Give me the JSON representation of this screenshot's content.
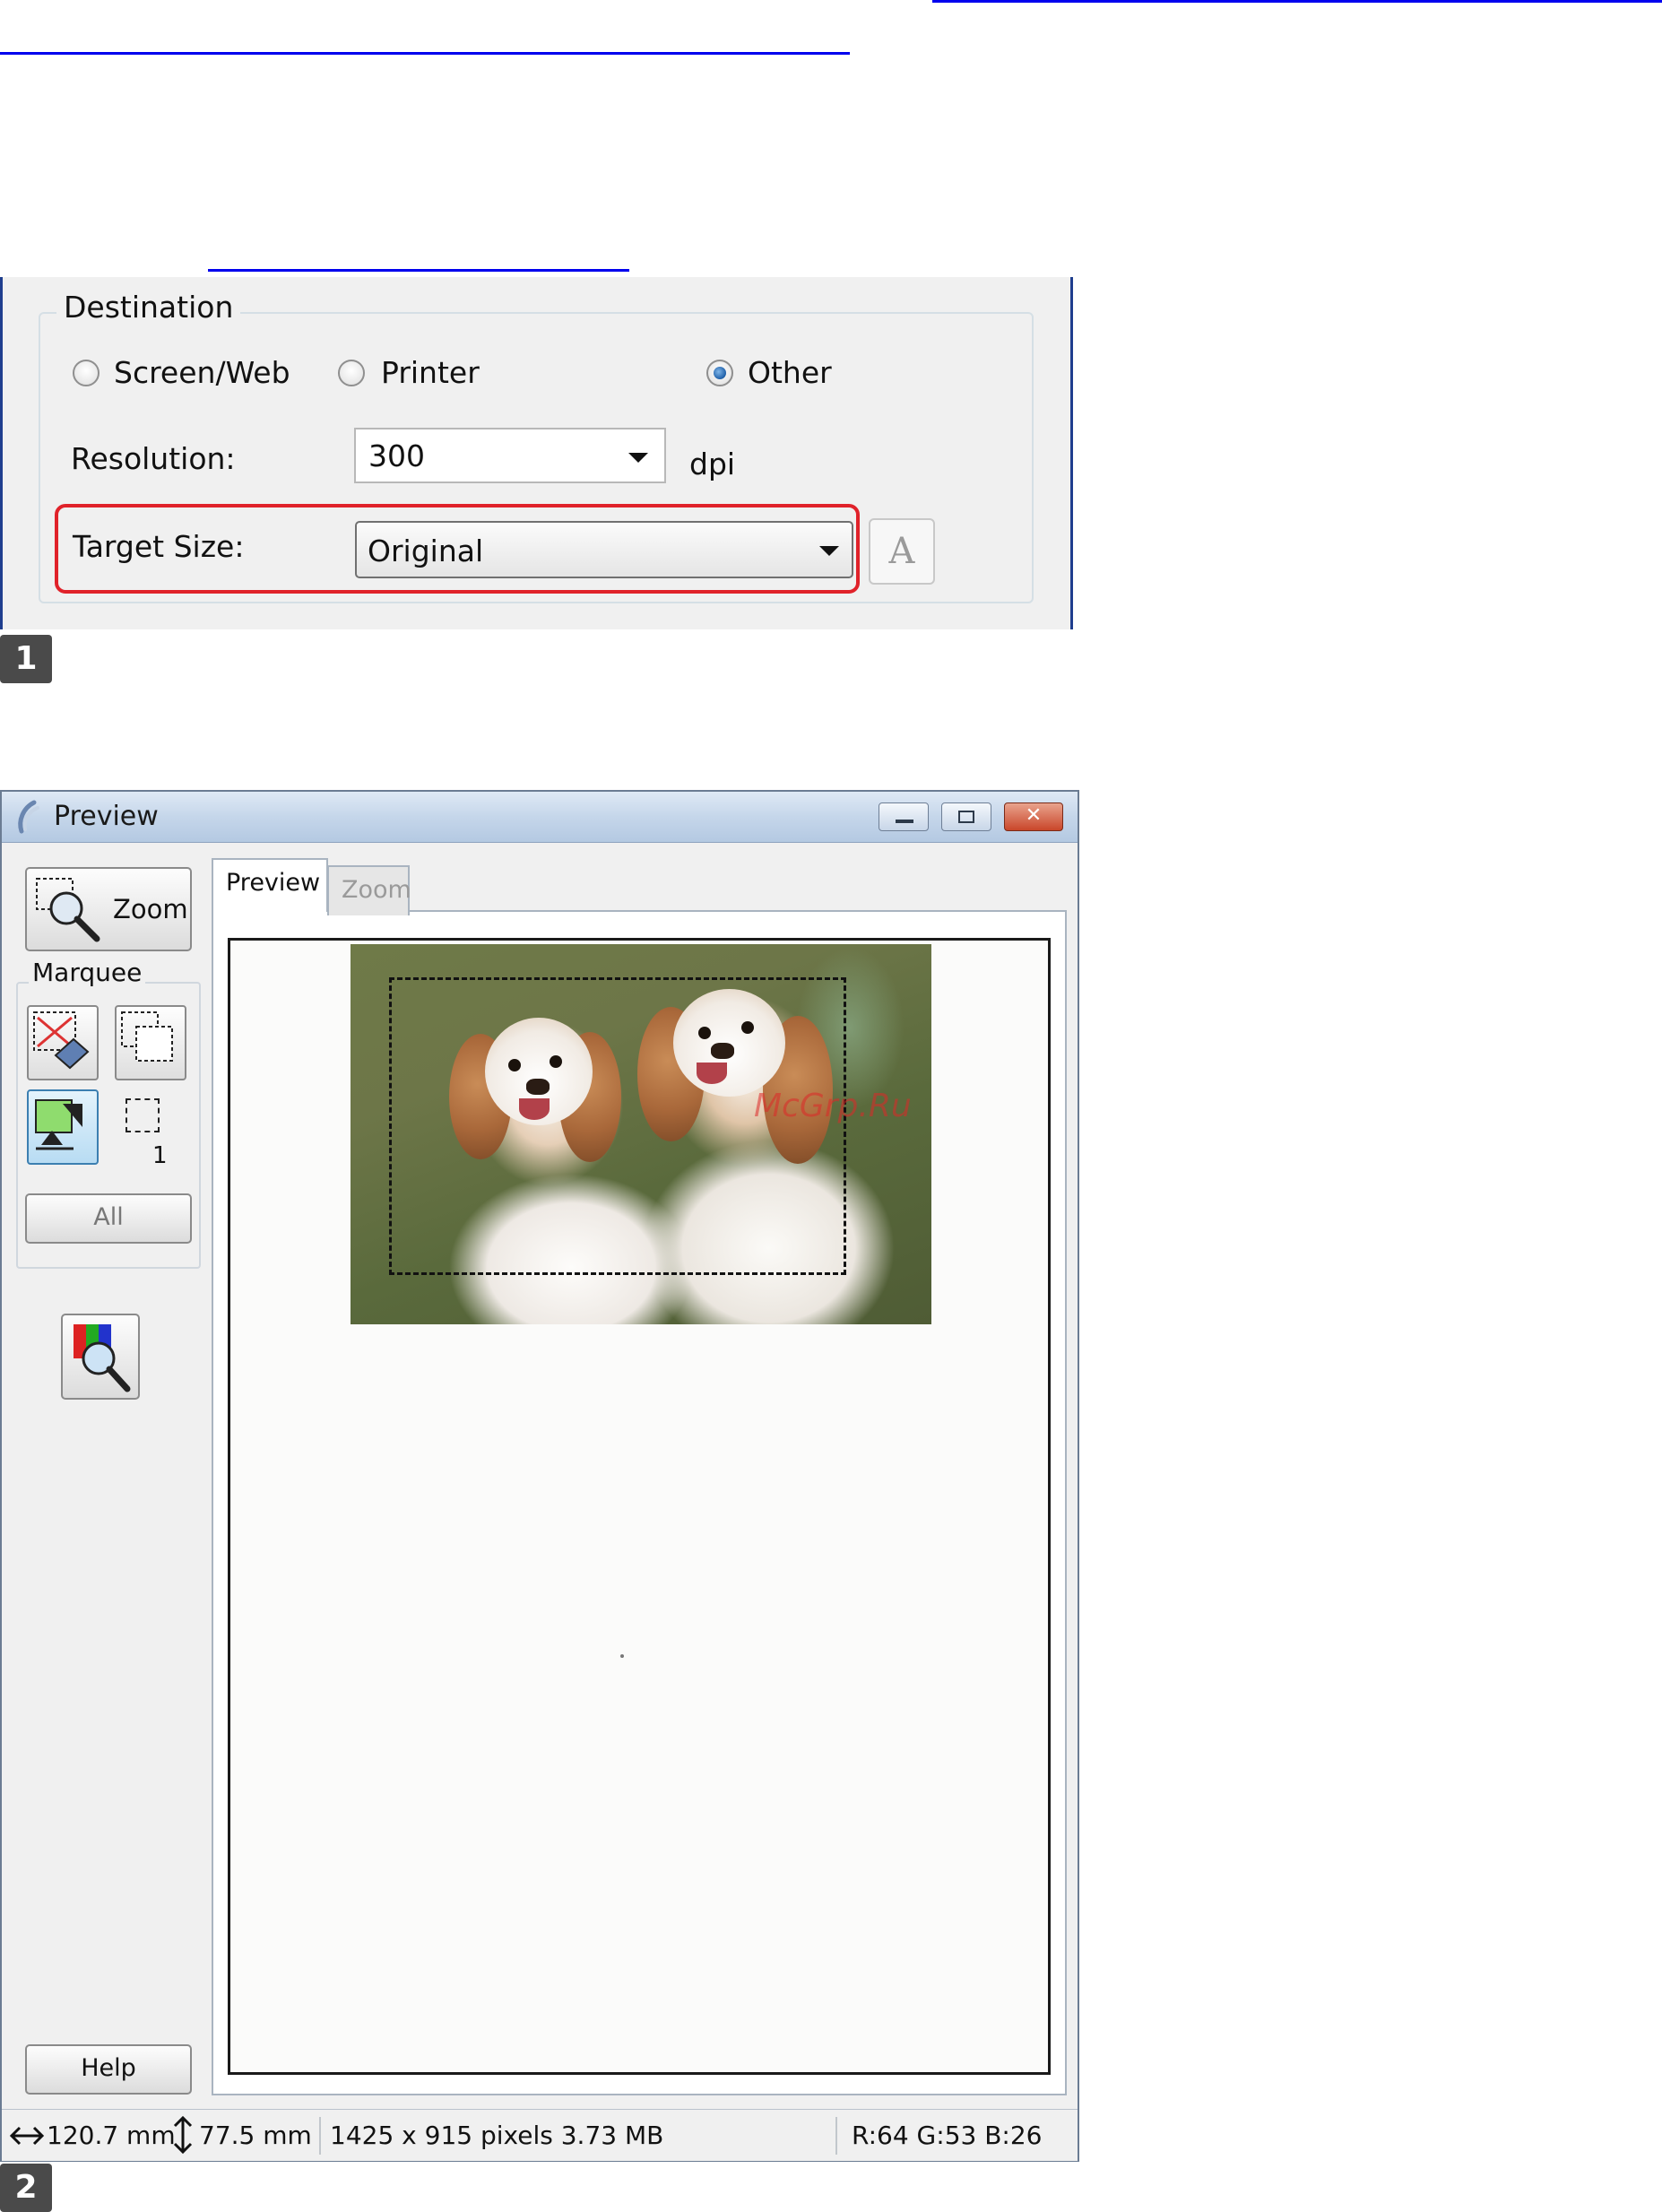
{
  "destination": {
    "legend": "Destination",
    "radios": [
      {
        "label": "Screen/Web",
        "checked": false
      },
      {
        "label": "Printer",
        "checked": false
      },
      {
        "label": "Other",
        "checked": true
      }
    ],
    "resolution_label": "Resolution:",
    "resolution_value": "300",
    "resolution_unit": "dpi",
    "target_size_label": "Target Size:",
    "target_size_value": "Original",
    "font_button_glyph": "A"
  },
  "step_badges": [
    "1",
    "2"
  ],
  "preview_window": {
    "title": "Preview",
    "title_icon": "scanner-icon",
    "window_buttons": [
      "minimize",
      "maximize",
      "close"
    ],
    "close_glyph": "✕",
    "zoom_button_label": "Zoom",
    "marquee_legend": "Marquee",
    "marquee_count": "1",
    "all_button": "All",
    "help_button": "Help",
    "tabs": [
      {
        "label": "Preview",
        "active": true
      },
      {
        "label": "Zoom",
        "active": false
      }
    ],
    "watermark": "McGrp.Ru",
    "status": {
      "width": "120.7 mm",
      "height": "77.5 mm",
      "pixels": "1425 x 915 pixels 3.73 MB",
      "rgb": "R:64 G:53 B:26"
    }
  },
  "colors": {
    "highlight": "#e0222a",
    "link": "#0000ee",
    "titlebar": "#c5d6ea"
  }
}
